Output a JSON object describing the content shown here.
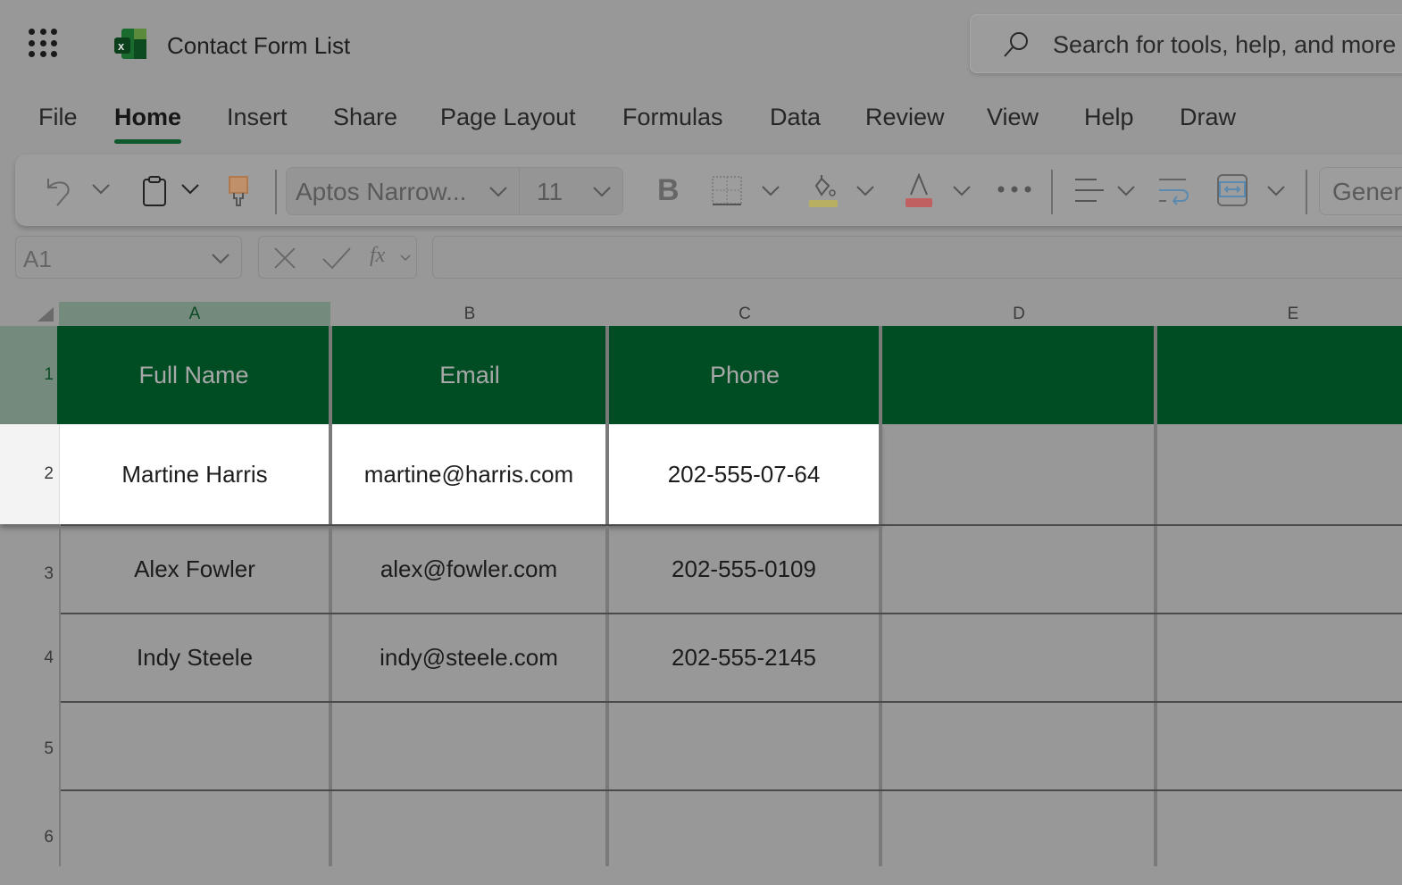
{
  "app": {
    "title": "Contact Form List"
  },
  "search": {
    "placeholder": "Search for tools, help, and more"
  },
  "menu_tabs": [
    {
      "label": "File"
    },
    {
      "label": "Home"
    },
    {
      "label": "Insert"
    },
    {
      "label": "Share"
    },
    {
      "label": "Page Layout"
    },
    {
      "label": "Formulas"
    },
    {
      "label": "Data"
    },
    {
      "label": "Review"
    },
    {
      "label": "View"
    },
    {
      "label": "Help"
    },
    {
      "label": "Draw"
    }
  ],
  "ribbon": {
    "font_name": "Aptos Narrow...",
    "font_size": "11",
    "bold_label": "B",
    "number_format": "General"
  },
  "formula_bar": {
    "name_box": "A1",
    "fx_label": "fx",
    "formula": ""
  },
  "sheet": {
    "columns": [
      "A",
      "B",
      "C",
      "D",
      "E"
    ],
    "row_numbers": [
      "1",
      "2",
      "3",
      "4",
      "5",
      "6"
    ],
    "headers": [
      "Full Name",
      "Email",
      "Phone"
    ],
    "rows": [
      [
        "Martine Harris",
        "martine@harris.com",
        "202-555-07-64"
      ],
      [
        "Alex Fowler",
        "alex@fowler.com",
        "202-555-0109"
      ],
      [
        "Indy Steele",
        "indy@steele.com",
        "202-555-2145"
      ]
    ]
  },
  "colors": {
    "header_fill": "#004d24",
    "accent": "#0e5a2c"
  }
}
